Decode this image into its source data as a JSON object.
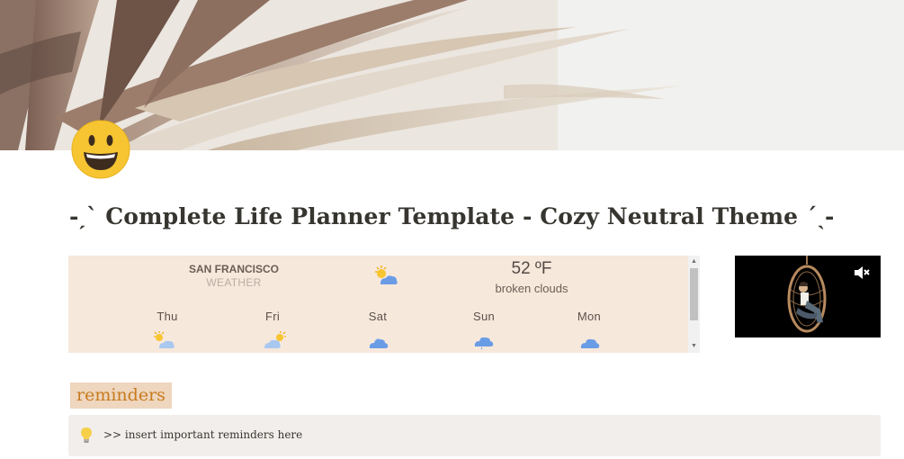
{
  "page": {
    "title": "-ˏˋ Complete Life Planner Template - Cozy Neutral Theme ˊˎ-",
    "emoji_icon": "grinning-face-emoji"
  },
  "weather": {
    "city": "SAN FRANCISCO",
    "label": "WEATHER",
    "current_icon": "partly-sunny-icon",
    "temperature": "52 ºF",
    "condition": "broken clouds",
    "forecast": [
      {
        "day": "Thu",
        "icon": "partly-sunny-icon"
      },
      {
        "day": "Fri",
        "icon": "sun-behind-cloud-icon"
      },
      {
        "day": "Sat",
        "icon": "cloud-icon"
      },
      {
        "day": "Sun",
        "icon": "rain-cloud-icon"
      },
      {
        "day": "Mon",
        "icon": "cloud-icon"
      }
    ]
  },
  "video": {
    "icon": "mute-icon"
  },
  "reminders": {
    "heading": "reminders",
    "callout_icon": "lightbulb-icon",
    "callout_text": ">> insert important reminders here"
  },
  "colors": {
    "weather_bg": "#f7e8dc",
    "heading_bg": "#eed6bf",
    "heading_text": "#c77b1d",
    "callout_bg": "#f1eeec"
  }
}
